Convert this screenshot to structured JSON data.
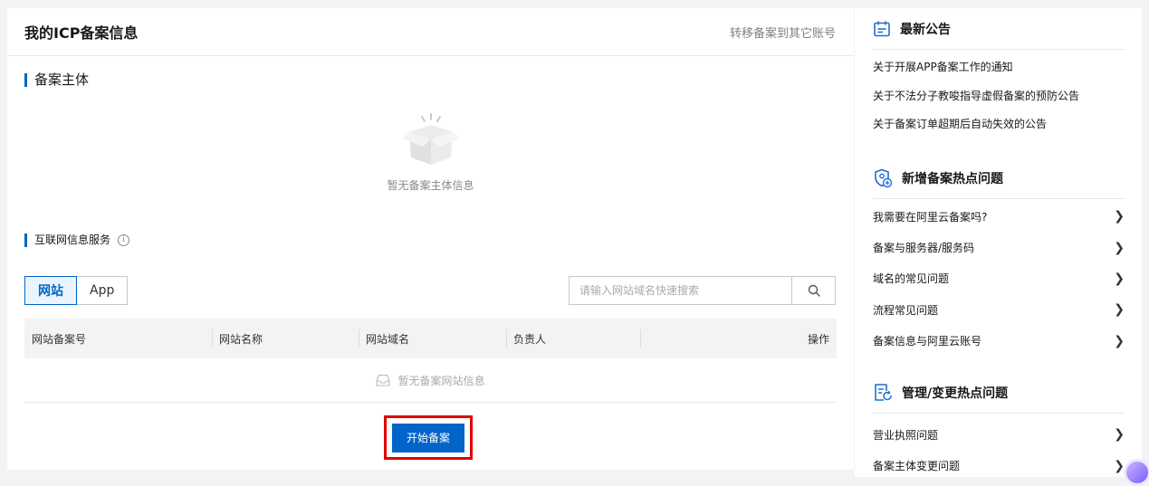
{
  "main": {
    "title": "我的ICP备案信息",
    "transfer_link": "转移备案到其它账号",
    "entity_section": {
      "title": "备案主体",
      "empty_text": "暂无备案主体信息"
    },
    "service_section": {
      "title": "互联网信息服务",
      "info_icon": "i"
    },
    "tabs": [
      {
        "label": "网站",
        "active": true
      },
      {
        "label": "App",
        "active": false
      }
    ],
    "search": {
      "placeholder": "请输入网站域名快速搜索",
      "value": ""
    },
    "table": {
      "headers": [
        "网站备案号",
        "网站名称",
        "网站域名",
        "负责人",
        "操作"
      ],
      "empty_text": "暂无备案网站信息"
    },
    "start_button": "开始备案"
  },
  "sidebar": {
    "notices": {
      "title": "最新公告",
      "icon": "calendar-icon",
      "items": [
        "关于开展APP备案工作的通知",
        "关于不法分子教唆指导虚假备案的预防公告",
        "关于备案订单超期后自动失效的公告"
      ]
    },
    "new_faq": {
      "title": "新增备案热点问题",
      "icon": "shield-user-icon",
      "items": [
        "我需要在阿里云备案吗?",
        "备案与服务器/服务码",
        "域名的常见问题",
        "流程常见问题",
        "备案信息与阿里云账号"
      ]
    },
    "change_faq": {
      "title": "管理/变更热点问题",
      "icon": "document-refresh-icon",
      "items": [
        "营业执照问题",
        "备案主体变更问题"
      ]
    }
  },
  "colors": {
    "primary": "#0064c8",
    "highlight_border": "#e00000"
  }
}
